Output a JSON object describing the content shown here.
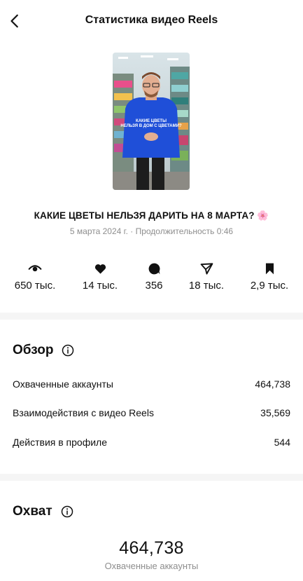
{
  "header": {
    "title": "Статистика видео Reels",
    "back_icon": "chevron-left-icon"
  },
  "video": {
    "thumbnail_overlay": "КАКИЕ ЦВЕТЫ НЕЛЬЗЯ В ДОМ С ЦВЕТАМИ?",
    "title": "КАКИЕ ЦВЕТЫ НЕЛЬЗЯ ДАРИТЬ НА 8 МАРТА? 🌸",
    "meta": "5 марта 2024 г. · Продолжительность 0:46"
  },
  "stats": [
    {
      "icon": "eye-icon",
      "value": "650 тыс."
    },
    {
      "icon": "heart-icon",
      "value": "14 тыс."
    },
    {
      "icon": "comment-icon",
      "value": "356"
    },
    {
      "icon": "share-icon",
      "value": "18 тыс."
    },
    {
      "icon": "bookmark-icon",
      "value": "2,9 тыс."
    }
  ],
  "overview": {
    "title": "Обзор",
    "rows": [
      {
        "label": "Охваченные аккаунты",
        "value": "464,738"
      },
      {
        "label": "Взаимодействия с видео Reels",
        "value": "35,569"
      },
      {
        "label": "Действия в профиле",
        "value": "544"
      }
    ]
  },
  "reach": {
    "title": "Охват",
    "value": "464,738",
    "label": "Охваченные аккаунты"
  },
  "colors": {
    "text": "#111111",
    "muted": "#8e8e8e",
    "divider": "#f5f5f5",
    "hoodie": "#1f4fd8"
  }
}
